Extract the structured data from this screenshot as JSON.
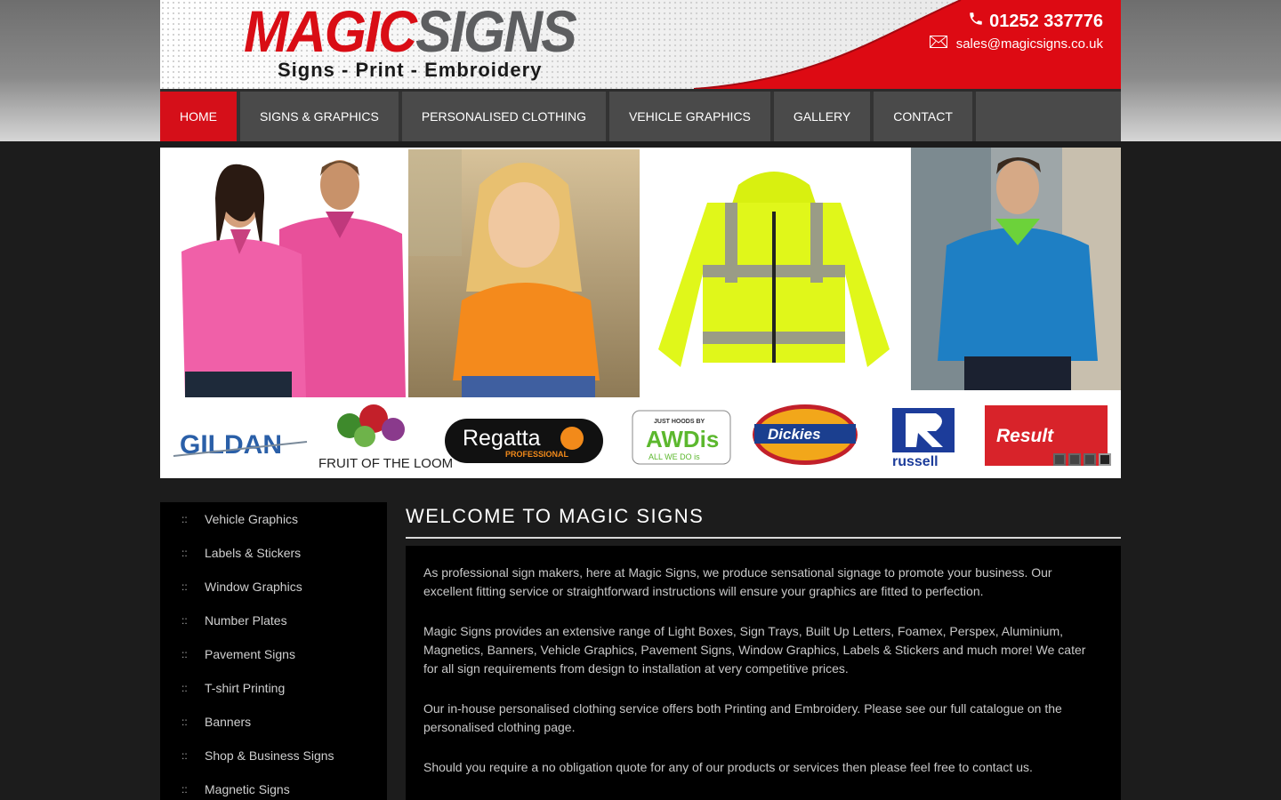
{
  "header": {
    "logo_part1": "MAGIC",
    "logo_part2": "SIGNS",
    "tagline": "Signs - Print - Embroidery",
    "phone": "01252 337776",
    "email": "sales@magicsigns.co.uk",
    "brand_red": "#d90d15"
  },
  "nav": {
    "items": [
      {
        "label": "HOME",
        "active": true
      },
      {
        "label": "SIGNS & GRAPHICS"
      },
      {
        "label": "PERSONALISED CLOTHING"
      },
      {
        "label": "VEHICLE GRAPHICS"
      },
      {
        "label": "GALLERY"
      },
      {
        "label": "CONTACT"
      }
    ]
  },
  "banner": {
    "brands": [
      "GILDAN",
      "FRUIT OF THE LOOM",
      "Regatta",
      "PROFESSIONAL",
      "JUST HOODS BY",
      "AWDis",
      "ALL WE DO is",
      "Dickies",
      "russell",
      "Result"
    ],
    "slide_count": 4,
    "active_slide": 4
  },
  "sidebar": {
    "bullet": "::",
    "items": [
      "Vehicle Graphics",
      "Labels & Stickers",
      "Window Graphics",
      "Number Plates",
      "Pavement Signs",
      "T-shirt Printing",
      "Banners",
      "Shop & Business Signs",
      "Magnetic Signs"
    ]
  },
  "main": {
    "title": "WELCOME TO MAGIC SIGNS",
    "paragraphs": [
      "As professional sign makers, here at Magic Signs, we produce sensational signage to promote your business. Our excellent fitting service or straightforward instructions will ensure your graphics are fitted to perfection.",
      "Magic Signs provides an extensive range of Light Boxes, Sign Trays, Built Up Letters, Foamex, Perspex, Aluminium, Magnetics, Banners, Vehicle Graphics, Pavement Signs, Window Graphics, Labels & Stickers and much more! We cater for all sign requirements from design to installation at very competitive prices.",
      "Our in-house personalised clothing service offers both Printing and Embroidery. Please see our full catalogue on the personalised clothing page.",
      "Should you require a no obligation quote for any of our products or services then please feel free to contact us."
    ]
  }
}
